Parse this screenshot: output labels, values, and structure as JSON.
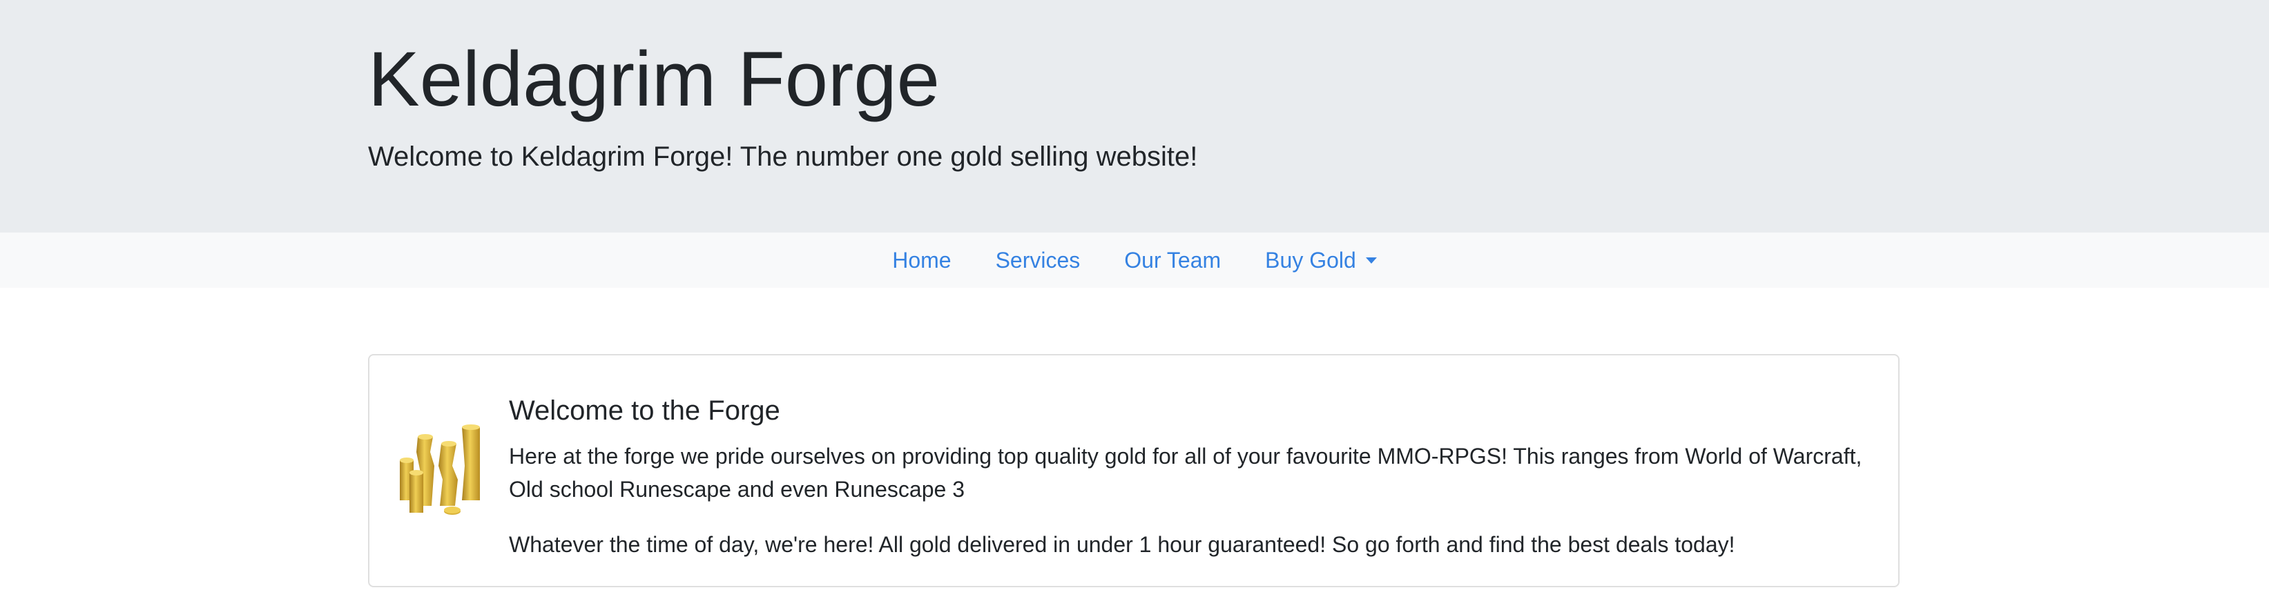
{
  "header": {
    "title": "Keldagrim Forge",
    "lead": "Welcome to Keldagrim Forge! The number one gold selling website!"
  },
  "nav": {
    "items": [
      {
        "label": "Home"
      },
      {
        "label": "Services"
      },
      {
        "label": "Our Team"
      },
      {
        "label": "Buy Gold",
        "dropdown": true
      }
    ]
  },
  "card": {
    "icon": "gold-coins-icon",
    "title": "Welcome to the Forge",
    "paragraph1": "Here at the forge we pride ourselves on providing top quality gold for all of your favourite MMO-RPGS! This ranges from World of Warcraft, Old school Runescape and even Runescape 3",
    "paragraph2": "Whatever the time of day, we're here! All gold delivered in under 1 hour guaranteed! So go forth and find the best deals today!"
  },
  "colors": {
    "header_bg": "#e9ecef",
    "nav_bg": "#f8f9fa",
    "link": "#3582e2",
    "text": "#212529",
    "gold": "#d9b23a"
  }
}
